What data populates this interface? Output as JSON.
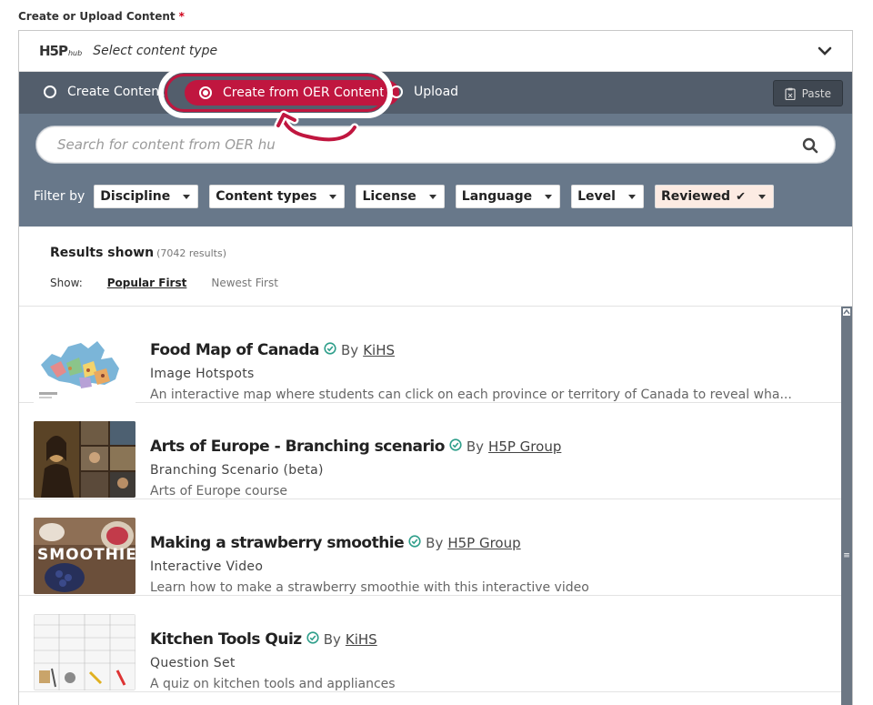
{
  "field": {
    "label": "Create or Upload Content",
    "required_mark": "*"
  },
  "hub": {
    "logo_main": "H5P",
    "logo_sub": "hub",
    "select_label": "Select content type"
  },
  "tabs": [
    {
      "label": "Create Content",
      "selected": false
    },
    {
      "label": "Create from OER Content",
      "selected": true
    },
    {
      "label": "Upload",
      "selected": false
    }
  ],
  "paste_label": "Paste",
  "search": {
    "placeholder": "Search for content from OER hu"
  },
  "filters": {
    "label": "Filter by",
    "items": [
      "Discipline",
      "Content types",
      "License",
      "Language",
      "Level",
      "Reviewed"
    ]
  },
  "results": {
    "title": "Results shown",
    "count": "(7042 results)",
    "show_label": "Show:",
    "sort_options": [
      "Popular First",
      "Newest First"
    ],
    "active_sort": "Popular First"
  },
  "items": [
    {
      "title": "Food Map of Canada",
      "by": "By",
      "author": "KiHS",
      "type": "Image Hotspots",
      "description": "An interactive map where students can click on each province or territory of Canada to reveal wha..."
    },
    {
      "title": "Arts of Europe - Branching scenario",
      "by": "By",
      "author": "H5P Group",
      "type": "Branching Scenario (beta)",
      "description": "Arts of Europe course"
    },
    {
      "title": "Making a strawberry smoothie",
      "by": "By",
      "author": "H5P Group",
      "type": "Interactive Video",
      "description": "Learn how to make a strawberry smoothie with this interactive video"
    },
    {
      "title": "Kitchen Tools Quiz",
      "by": "By",
      "author": "KiHS",
      "type": "Question Set",
      "description": "A quiz on kitchen tools and appliances"
    }
  ],
  "thumb_texts": {
    "smoothie": "SMOOTHIE"
  },
  "colors": {
    "accent": "#c0163f",
    "tabbar": "#535e6c",
    "searchzone": "#68788a",
    "verified": "#2e9e8a"
  }
}
